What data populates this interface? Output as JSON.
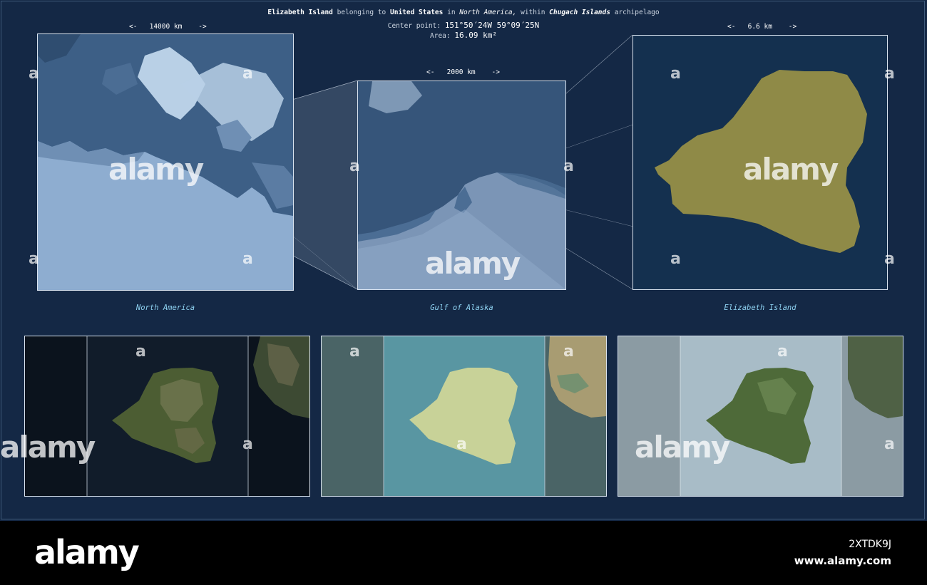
{
  "header": {
    "island_name": "Elizabeth Island",
    "belonging_to_text": "belonging to",
    "country": "United States",
    "in_text": "in",
    "continent": "North America,",
    "within_text": "within",
    "archipelago": "Chugach Islands",
    "archipelago_suffix": "archipelago",
    "center_label": "Center point:",
    "center_value": "151°50´24W  59°09´25N",
    "area_label": "Area:",
    "area_value": "16.09 km²"
  },
  "maps": {
    "north_america": {
      "scale": "<-   14000 km    ->",
      "caption": "North America"
    },
    "gulf_of_alaska": {
      "scale": "<-   2000 km    ->",
      "caption": "Gulf of Alaska"
    },
    "elizabeth_island": {
      "scale": "<-   6.6 km    ->",
      "caption": "Elizabeth Island"
    }
  },
  "colors": {
    "background": "#142845",
    "island_fill": "#8f8a47",
    "caption": "#8fd3f2",
    "panel_border": "#d9e3ef"
  },
  "watermark": {
    "text": "alamy",
    "small": "a"
  },
  "footer": {
    "logo": "alamy",
    "image_id": "2XTDK9J",
    "url": "www.alamy.com"
  }
}
